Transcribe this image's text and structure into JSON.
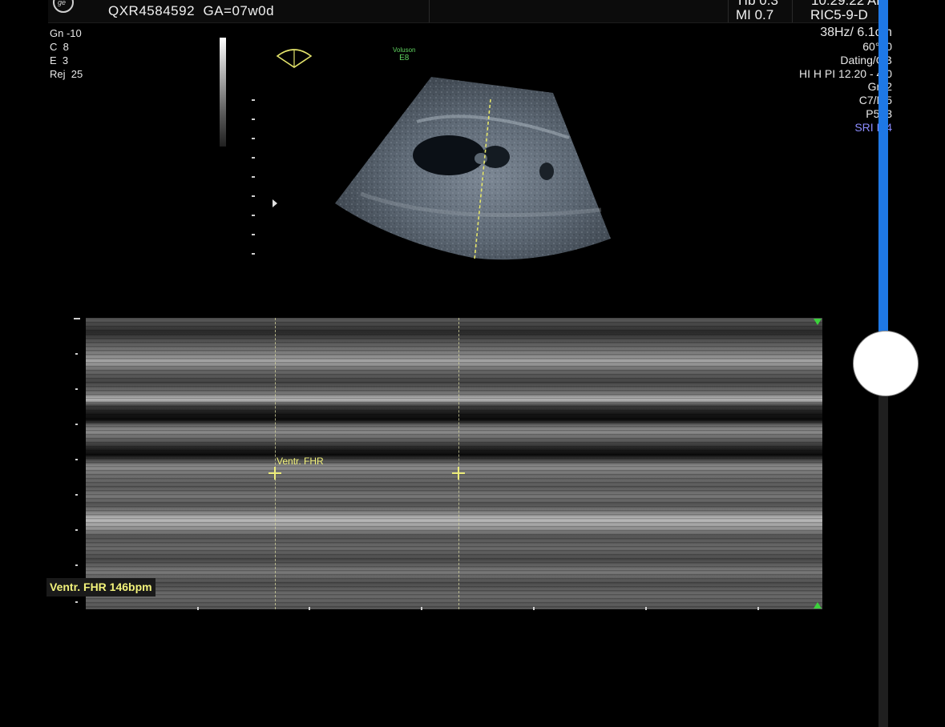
{
  "header": {
    "patient_id": "QXR4584592",
    "gestational_age": "GA=07w0d",
    "tib": "TIb 0.3",
    "mi": "MI  0.7",
    "time": "10:29:22 AM",
    "probe": "RIC5-9-D"
  },
  "left_params": [
    "Gn -10",
    "C  8",
    "E  3",
    "Rej  25"
  ],
  "right_params": {
    "frame_depth": "38Hz/ 6.1cm",
    "angle": "60°/ 0",
    "preset": "Dating/OB",
    "harmonic": "HI H PI 12.20 - 4.0",
    "gain": "Gn  2",
    "c": "C7/M5",
    "p": "P5/ 3",
    "sri": "SRI II 4"
  },
  "brand": {
    "line1": "Voluson",
    "line2": "E8"
  },
  "measurement": {
    "caliper_label": "Ventr. FHR",
    "result": "Ventr. FHR 146bpm"
  },
  "colors": {
    "caliper": "#f2f27a",
    "slider_fill": "#1e78e6",
    "brand_green": "#5fd35f"
  },
  "slider": {
    "value_fraction": 0.5
  },
  "icons": {
    "probe": "sector-probe-icon",
    "logo": "ge-logo-icon"
  }
}
